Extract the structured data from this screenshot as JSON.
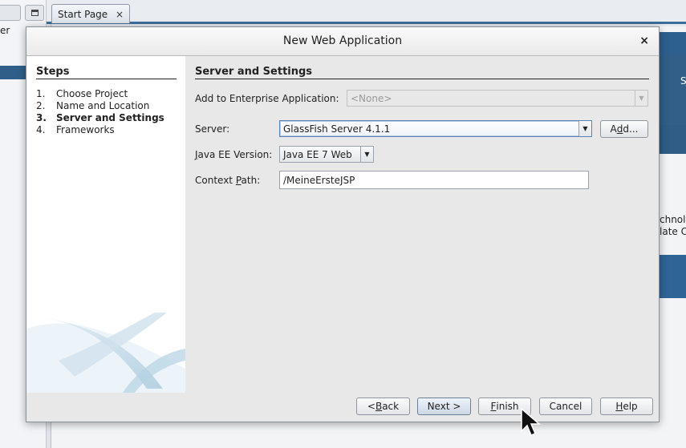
{
  "ide": {
    "left_text": "er",
    "tab_label": "Start Page",
    "tab_close": "×",
    "right_band_text": "S",
    "right_text_line1": "chnolo",
    "right_text_line2": "late C"
  },
  "dialog": {
    "title": "New Web Application",
    "close_glyph": "×"
  },
  "steps": {
    "heading": "Steps",
    "items": [
      {
        "num": "1.",
        "label": "Choose Project",
        "active": false
      },
      {
        "num": "2.",
        "label": "Name and Location",
        "active": false
      },
      {
        "num": "3.",
        "label": "Server and Settings",
        "active": true
      },
      {
        "num": "4.",
        "label": "Frameworks",
        "active": false
      }
    ]
  },
  "settings": {
    "heading": "Server and Settings",
    "enterprise_label": "Add to Enterprise Application:",
    "enterprise_value": "<None>",
    "server_label": "Server:",
    "server_value": "GlassFish Server 4.1.1",
    "add_button": {
      "pre": "A",
      "mn": "d",
      "post": "d..."
    },
    "javaee_label": {
      "pre": "",
      "mn": "J",
      "post": "ava EE Version:"
    },
    "javaee_value": "Java EE 7 Web",
    "context_label": {
      "pre": "Context ",
      "mn": "P",
      "post": "ath:"
    },
    "context_value": "/MeineErsteJSP"
  },
  "buttons": {
    "back": {
      "pre": "< ",
      "mn": "B",
      "post": "ack"
    },
    "next": {
      "pre": "Next >",
      "mn": "",
      "post": ""
    },
    "finish": {
      "pre": "",
      "mn": "F",
      "post": "inish"
    },
    "cancel": {
      "pre": "Cancel",
      "mn": "",
      "post": ""
    },
    "help": {
      "pre": "",
      "mn": "H",
      "post": "elp"
    }
  },
  "icons": {
    "dropdown": "dropdown-arrow-icon",
    "close": "close-icon",
    "cursor": "mouse-pointer-icon"
  },
  "colors": {
    "ide_accent": "#3b6d9a",
    "dialog_bg": "#e8e8e8",
    "focus_border": "#5c83b4"
  }
}
